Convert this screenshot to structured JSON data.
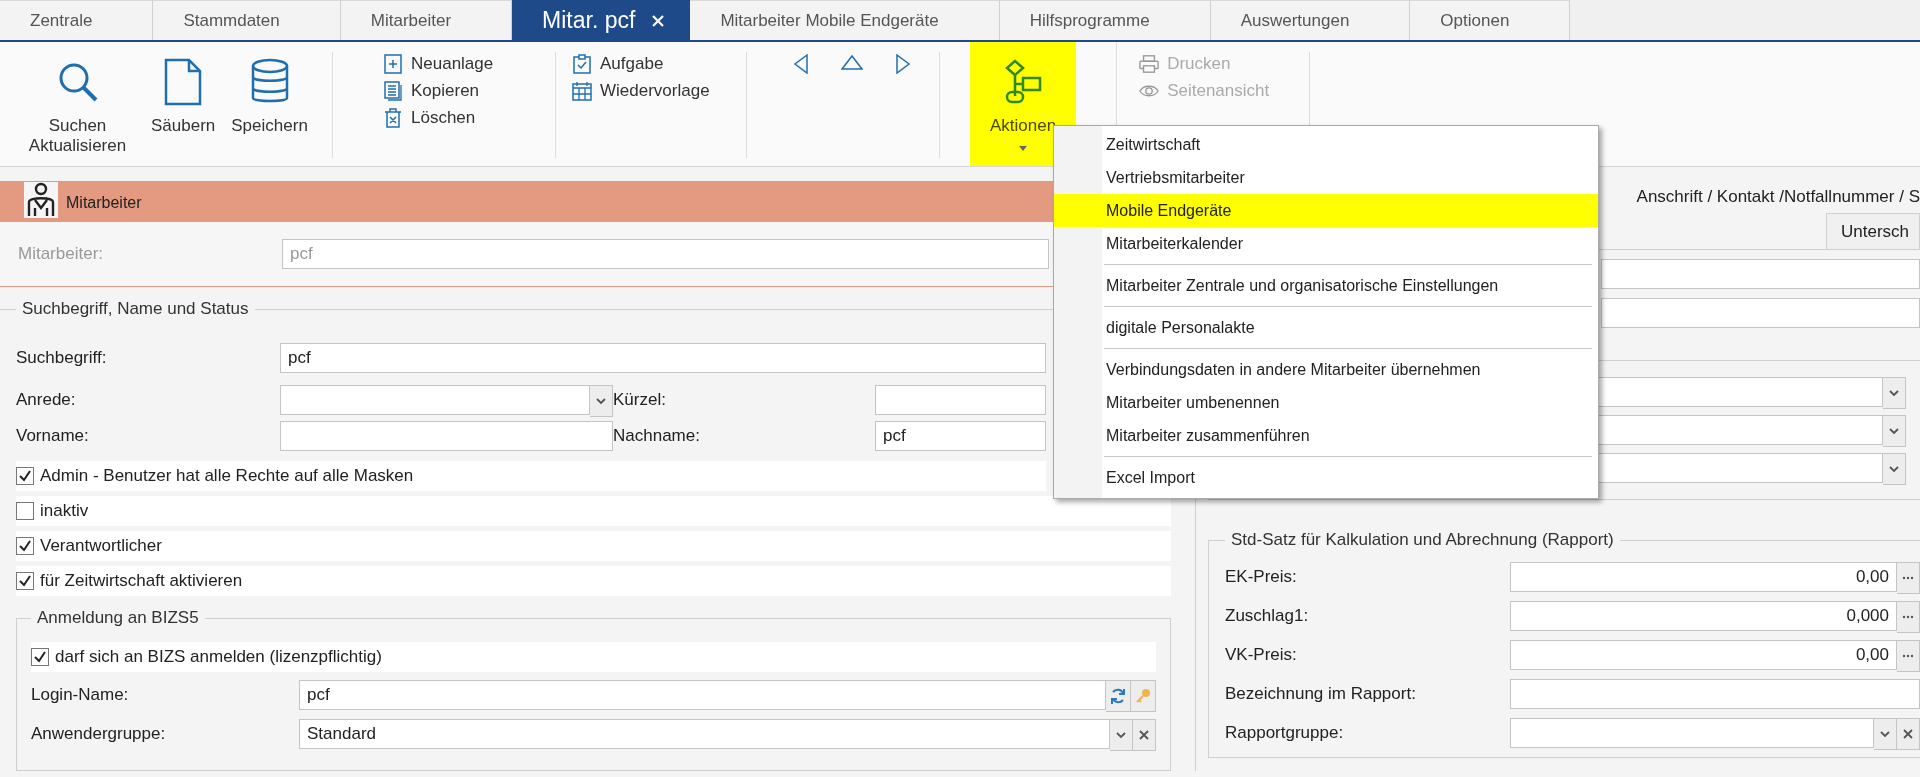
{
  "tabs": [
    {
      "label": "Zentrale",
      "selected": false,
      "closable": false
    },
    {
      "label": "Stammdaten",
      "selected": false,
      "closable": false
    },
    {
      "label": "Mitarbeiter",
      "selected": false,
      "closable": false
    },
    {
      "label": "Mitar. pcf",
      "selected": true,
      "closable": true
    },
    {
      "label": "Mitarbeiter Mobile Endgeräte",
      "selected": false,
      "closable": false
    },
    {
      "label": "Hilfsprogramme",
      "selected": false,
      "closable": false
    },
    {
      "label": "Auswertungen",
      "selected": false,
      "closable": false
    },
    {
      "label": "Optionen",
      "selected": false,
      "closable": false
    }
  ],
  "ribbon": {
    "groups": [
      {
        "kind": "large",
        "buttons": [
          {
            "label": "Suchen Aktualisieren",
            "disabled": false,
            "selected": false
          },
          {
            "label": "Säubern",
            "disabled": false,
            "selected": false
          },
          {
            "label": "Speichern",
            "disabled": false,
            "selected": false
          }
        ]
      },
      {
        "kind": "small",
        "buttons": [
          {
            "label": "Neuanlage",
            "disabled": false
          },
          {
            "label": "Kopieren",
            "disabled": false
          },
          {
            "label": "Löschen",
            "disabled": false
          }
        ]
      },
      {
        "kind": "small",
        "buttons": [
          {
            "label": "Aufgabe",
            "disabled": false
          },
          {
            "label": "Wiedervorlage",
            "disabled": false
          }
        ]
      },
      {
        "kind": "nav"
      },
      {
        "kind": "large",
        "buttons": [
          {
            "label": "Aktionen",
            "disabled": false,
            "selected": true,
            "dropdown": true
          }
        ]
      },
      {
        "kind": "small",
        "buttons": [
          {
            "label": "Drucken",
            "disabled": true
          },
          {
            "label": "Seitenansicht",
            "disabled": true
          }
        ]
      }
    ]
  },
  "menu": {
    "sections": [
      {
        "items": [
          {
            "label": "Zeitwirtschaft",
            "selected": false
          },
          {
            "label": "Vertriebsmitarbeiter",
            "selected": false
          },
          {
            "label": "Mobile Endgeräte",
            "selected": true
          },
          {
            "label": "Mitarbeiterkalender",
            "selected": false
          }
        ]
      },
      {
        "items": [
          {
            "label": "Mitarbeiter Zentrale und organisatorische Einstellungen",
            "selected": false
          }
        ]
      },
      {
        "items": [
          {
            "label": "digitale Personalakte",
            "selected": false
          }
        ]
      },
      {
        "items": [
          {
            "label": "Verbindungsdaten in andere Mitarbeiter übernehmen",
            "selected": false
          },
          {
            "label": "Mitarbeiter umbenennen",
            "selected": false
          },
          {
            "label": "Mitarbeiter zusammenführen",
            "selected": false
          }
        ]
      },
      {
        "items": [
          {
            "label": "Excel Import",
            "selected": false
          }
        ]
      }
    ]
  },
  "employee_panel": {
    "title": "Mitarbeiter",
    "field": {
      "label": "Mitarbeiter:",
      "value": "pcf",
      "disabled": true
    }
  },
  "name_status": {
    "title": "Suchbegriff, Name und Status",
    "rows": [
      {
        "fields": [
          {
            "kind": "text",
            "label": "Suchbegriff:",
            "value": "pcf"
          }
        ]
      },
      {
        "fields": [
          {
            "kind": "combo",
            "label": "Anrede:"
          },
          {
            "kind": "text",
            "label": "Kürzel:"
          }
        ]
      },
      {
        "fields": [
          {
            "kind": "text",
            "label": "Vorname:"
          },
          {
            "kind": "text",
            "label": "Nachname:",
            "value": "pcf"
          }
        ]
      }
    ],
    "checkboxes": [
      {
        "label": "Admin - Benutzer hat alle Rechte auf alle Masken",
        "checked": true
      },
      {
        "label": "inaktiv",
        "checked": false
      },
      {
        "label": "Verantwortlicher",
        "checked": true
      },
      {
        "label": "für Zeitwirtschaft aktivieren",
        "checked": true
      }
    ],
    "login": {
      "title": "Anmeldung an BIZS5",
      "checkbox": {
        "label": "darf sich an BIZS anmelden (lizenzpflichtig)",
        "checked": true
      },
      "fields": [
        {
          "kind": "login",
          "label": "Login-Name:",
          "value": "pcf"
        },
        {
          "kind": "combo_clear",
          "label": "Anwendergruppe:",
          "value": "Standard"
        }
      ]
    }
  },
  "detail": {
    "header": "Anschrift / Kontakt /Notfallnummer / S",
    "tab": "Untersch",
    "rates": {
      "title": "Std-Satz für Kalkulation und Abrechnung (Rapport)",
      "fields": [
        {
          "kind": "ellipsis",
          "label": "EK-Preis:",
          "value": "0,00"
        },
        {
          "kind": "ellipsis",
          "label": "Zuschlag1:",
          "value": "0,000"
        },
        {
          "kind": "ellipsis",
          "label": "VK-Preis:",
          "value": "0,00"
        },
        {
          "kind": "text",
          "label": "Bezeichnung im Rapport:"
        },
        {
          "kind": "combo_clear",
          "label": "Rapportgruppe:"
        }
      ]
    }
  }
}
